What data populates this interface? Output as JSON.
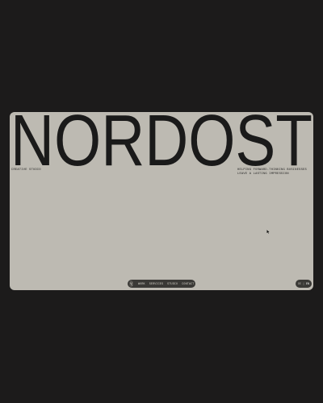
{
  "brand": {
    "wordmark": "NORDOST",
    "tagline": "Creative Studio",
    "statement": "Helping forward-thinking businesses leave a lasting impression"
  },
  "nav": {
    "logo_icon": "nordost-logo-icon",
    "items": [
      {
        "label": "Work"
      },
      {
        "label": "Services"
      },
      {
        "label": "Studio"
      },
      {
        "label": "Contact"
      }
    ]
  },
  "lang": {
    "options": [
      "DE",
      "EN"
    ],
    "separator": "|",
    "active": "EN"
  },
  "colors": {
    "page_background": "#1c1b1b",
    "card_background": "#bdbab2",
    "ink": "#1a1a1a",
    "nav_pill": "#3a3936"
  }
}
